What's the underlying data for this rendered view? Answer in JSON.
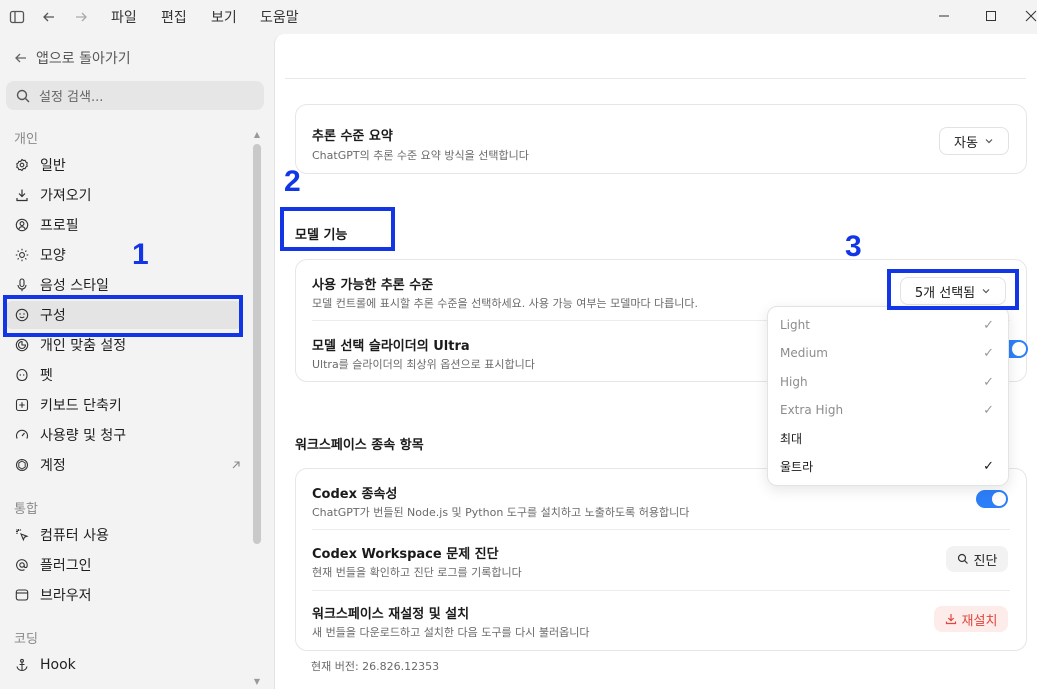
{
  "titlebar": {
    "menus": [
      "파일",
      "편집",
      "보기",
      "도움말"
    ]
  },
  "sidebar": {
    "back_label": "앱으로 돌아가기",
    "search_placeholder": "설정 검색...",
    "sections": [
      {
        "label": "개인",
        "items": [
          {
            "label": "일반",
            "icon": "gear-icon"
          },
          {
            "label": "가져오기",
            "icon": "download-icon"
          },
          {
            "label": "프로필",
            "icon": "profile-icon"
          },
          {
            "label": "모양",
            "icon": "sun-icon"
          },
          {
            "label": "음성 스타일",
            "icon": "mic-icon"
          },
          {
            "label": "구성",
            "icon": "face-icon",
            "active": true
          },
          {
            "label": "개인 맞춤 설정",
            "icon": "personalize-icon"
          },
          {
            "label": "펫",
            "icon": "pet-icon"
          },
          {
            "label": "키보드 단축키",
            "icon": "keyboard-icon"
          },
          {
            "label": "사용량 및 청구",
            "icon": "gauge-icon"
          },
          {
            "label": "계정",
            "icon": "account-icon",
            "external": true
          }
        ]
      },
      {
        "label": "통합",
        "items": [
          {
            "label": "컴퓨터 사용",
            "icon": "cursor-icon"
          },
          {
            "label": "플러그인",
            "icon": "at-icon"
          },
          {
            "label": "브라우저",
            "icon": "browser-icon"
          }
        ]
      },
      {
        "label": "코딩",
        "items": [
          {
            "label": "Hook",
            "icon": "anchor-icon"
          }
        ]
      }
    ]
  },
  "main": {
    "reasoning_summary": {
      "title": "추론 수준 요약",
      "desc": "ChatGPT의 추론 수준 요약 방식을 선택합니다",
      "value": "자동"
    },
    "model_features": {
      "section_title": "모델 기능",
      "available_levels": {
        "title": "사용 가능한 추론 수준",
        "desc": "모델 컨트롤에 표시할 추론 수준을 선택하세요. 사용 가능 여부는 모델마다 다릅니다.",
        "value": "5개 선택됨"
      },
      "ultra_slider": {
        "title": "모델 선택 슬라이더의 Ultra",
        "desc": "Ultra를 슬라이더의 최상위 옵션으로 표시합니다"
      }
    },
    "workspace": {
      "section_title": "워크스페이스 종속 항목",
      "codex_deps": {
        "title": "Codex 종속성",
        "desc": "ChatGPT가 번들된 Node.js 및 Python 도구를 설치하고 노출하도록 허용합니다",
        "enabled": true
      },
      "diagnose": {
        "title": "Codex Workspace 문제 진단",
        "desc": "현재 번들을 확인하고 진단 로그를 기록합니다",
        "button": "진단"
      },
      "reinstall": {
        "title": "워크스페이스 재설정 및 설치",
        "desc": "새 번들을 다운로드하고 설치한 다음 도구를 다시 불러옵니다",
        "button": "재설치"
      },
      "version": "현재 버전: 26.826.12353"
    }
  },
  "dropdown": {
    "items": [
      {
        "label": "Light",
        "checked": true,
        "muted": true
      },
      {
        "label": "Medium",
        "checked": true,
        "muted": true
      },
      {
        "label": "High",
        "checked": true,
        "muted": true
      },
      {
        "label": "Extra High",
        "checked": true,
        "muted": true
      },
      {
        "label": "최대",
        "checked": false,
        "muted": false
      },
      {
        "label": "울트라",
        "checked": true,
        "muted": false
      }
    ],
    "check_glyph": "✓"
  },
  "annotations": {
    "labels": [
      "1",
      "2",
      "3"
    ],
    "color": "#1236e6"
  },
  "colors": {
    "accent": "#2d7ff9",
    "danger": "#e0463c",
    "danger_bg": "#fdecea"
  }
}
